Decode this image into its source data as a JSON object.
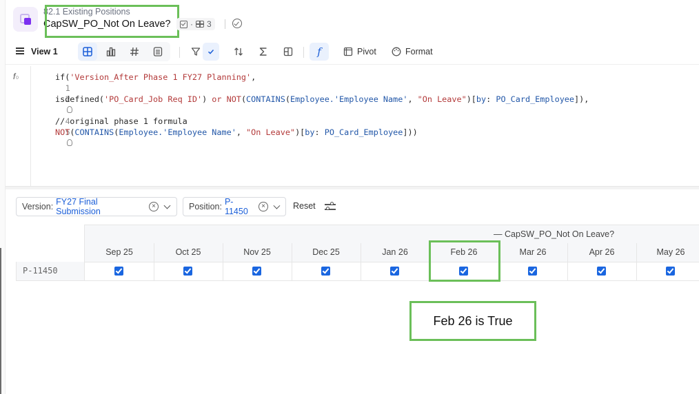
{
  "header": {
    "subtitle": "82.1 Existing Positions",
    "title": "CapSW_PO_Not On Leave?",
    "meta_count": "3"
  },
  "toolbar": {
    "view_label": "View 1",
    "pivot_label": "Pivot",
    "format_label": "Format"
  },
  "formula": {
    "lines": [
      {
        "num": "1",
        "text": "if('Version_After Phase 1 FY27 Planning',"
      },
      {
        "num": "2",
        "text": ""
      },
      {
        "num": "3",
        "text": "isdefined('PO_Card_Job Req ID') or NOT(CONTAINS(Employee.'Employee Name', \"On Leave\")[by: PO_Card_Employee]),"
      },
      {
        "num": "4",
        "text": ""
      },
      {
        "num": "5",
        "text": "// original phase 1 formula"
      },
      {
        "num": "6",
        "text": "NOT(CONTAINS(Employee.'Employee Name', \"On Leave\")[by: PO_Card_Employee]))"
      }
    ]
  },
  "filters": {
    "version_label": "Version:",
    "version_value": "FY27 Final Submission",
    "position_label": "Position:",
    "position_value": "P-11450",
    "reset_label": "Reset"
  },
  "table": {
    "group_title": "— CapSW_PO_Not On Leave?",
    "columns": [
      "Sep 25",
      "Oct 25",
      "Nov 25",
      "Dec 25",
      "Jan 26",
      "Feb 26",
      "Mar 26",
      "Apr 26",
      "May 26"
    ],
    "rows": [
      {
        "label": "P-11450",
        "values": [
          true,
          true,
          true,
          true,
          true,
          true,
          true,
          true,
          true
        ]
      }
    ]
  },
  "annotation": {
    "text": "Feb 26 is True",
    "highlight_color": "#6bbf59"
  },
  "colors": {
    "accent": "#1a5ed8",
    "checkbox": "#1a66e0",
    "brand": "#7b2ff0"
  }
}
